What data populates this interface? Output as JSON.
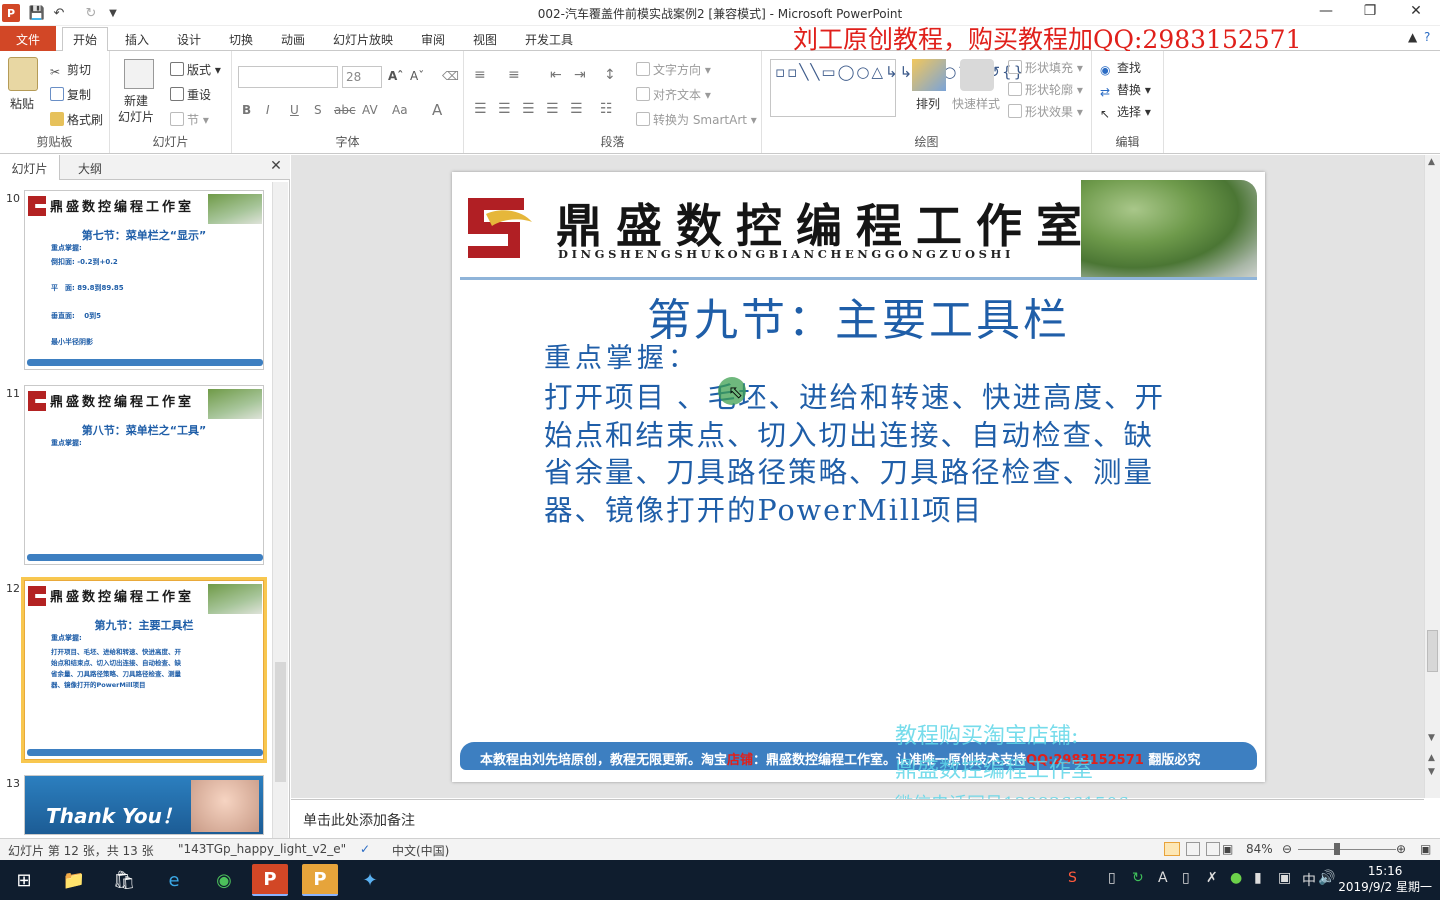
{
  "window": {
    "title": "002-汽车覆盖件前模实战案例2 [兼容模式] - Microsoft PowerPoint"
  },
  "tabs": [
    "文件",
    "开始",
    "插入",
    "设计",
    "切换",
    "动画",
    "幻灯片放映",
    "审阅",
    "视图",
    "开发工具"
  ],
  "watermark_top": "刘工原创教程，购买教程加QQ:2983152571",
  "ribbon": {
    "clipboard": {
      "paste": "粘贴",
      "cut": "剪切",
      "copy": "复制",
      "format_painter": "格式刷",
      "label": "剪贴板"
    },
    "slides": {
      "new_slide": "新建\n幻灯片",
      "layout": "版式",
      "reset": "重设",
      "section": "节",
      "label": "幻灯片"
    },
    "font": {
      "size": "28",
      "label": "字体"
    },
    "paragraph": {
      "text_direction": "文字方向",
      "align_text": "对齐文本",
      "smartart": "转换为 SmartArt",
      "label": "段落"
    },
    "drawing": {
      "arrange": "排列",
      "quick_styles": "快速样式",
      "shape_fill": "形状填充",
      "shape_outline": "形状轮廓",
      "shape_effects": "形状效果",
      "label": "绘图"
    },
    "editing": {
      "find": "查找",
      "replace": "替换",
      "select": "选择",
      "label": "编辑"
    }
  },
  "left_pane": {
    "tabs": [
      "幻灯片",
      "大纲"
    ],
    "thumbs": [
      {
        "num": "10",
        "heading": "第七节：菜单栏之“显示”",
        "lines": [
          "重点掌握:",
          "倒扣面: -0.2到+0.2",
          "平　面: 89.8到89.85",
          "垂直面: 　0到5",
          "最小半径阴影"
        ]
      },
      {
        "num": "11",
        "heading": "第八节：菜单栏之“工具”",
        "lines": [
          "重点掌握:"
        ]
      },
      {
        "num": "12",
        "heading": "第九节：主要工具栏",
        "lines": [
          "重点掌握:",
          "打开项目、毛坯、进给和转速、快进高度、开",
          "始点和结束点、切入切出连接、自动检查、缺",
          "省余量、刀具路径策略、刀具路径检查、测量",
          "器、镜像打开的PowerMill项目"
        ]
      },
      {
        "num": "13",
        "heading": "Thank You！",
        "lines": []
      }
    ]
  },
  "slide": {
    "brand_title": "鼎盛数控编程工作室",
    "brand_sub": "DINGSHENGSHUKONGBIANCHENGGONGZUOSHI",
    "heading": "第九节：主要工具栏",
    "subheading": "重点掌握：",
    "body": [
      "打开项目 、毛坯、进给和转速、快进高度、开",
      "始点和结束点、切入切出连接、自动检查、缺",
      "省余量、刀具路径策略、刀具路径检查、测量",
      "器、镜像打开的PowerMill项目"
    ],
    "footer_a": "本教程由刘先培原创，教程无限更新。淘宝",
    "footer_b": "店铺",
    "footer_c": "：鼎盛数控编程工作室。认准唯一原创技术支持",
    "footer_d": "QQ:2983152571",
    "footer_e": " 翻版必究"
  },
  "shop_watermark": [
    "教程购买淘宝店铺:",
    "鼎盛数控编程工作室",
    "微信电话同号13883661506"
  ],
  "notes_placeholder": "单击此处添加备注",
  "status": {
    "slide_info": "幻灯片 第 12 张，共 13 张",
    "theme": "\"143TGp_happy_light_v2_e\"",
    "language": "中文(中国)",
    "zoom": "84%"
  },
  "clock": {
    "time": "15:16",
    "date": "2019/9/2 星期一"
  }
}
